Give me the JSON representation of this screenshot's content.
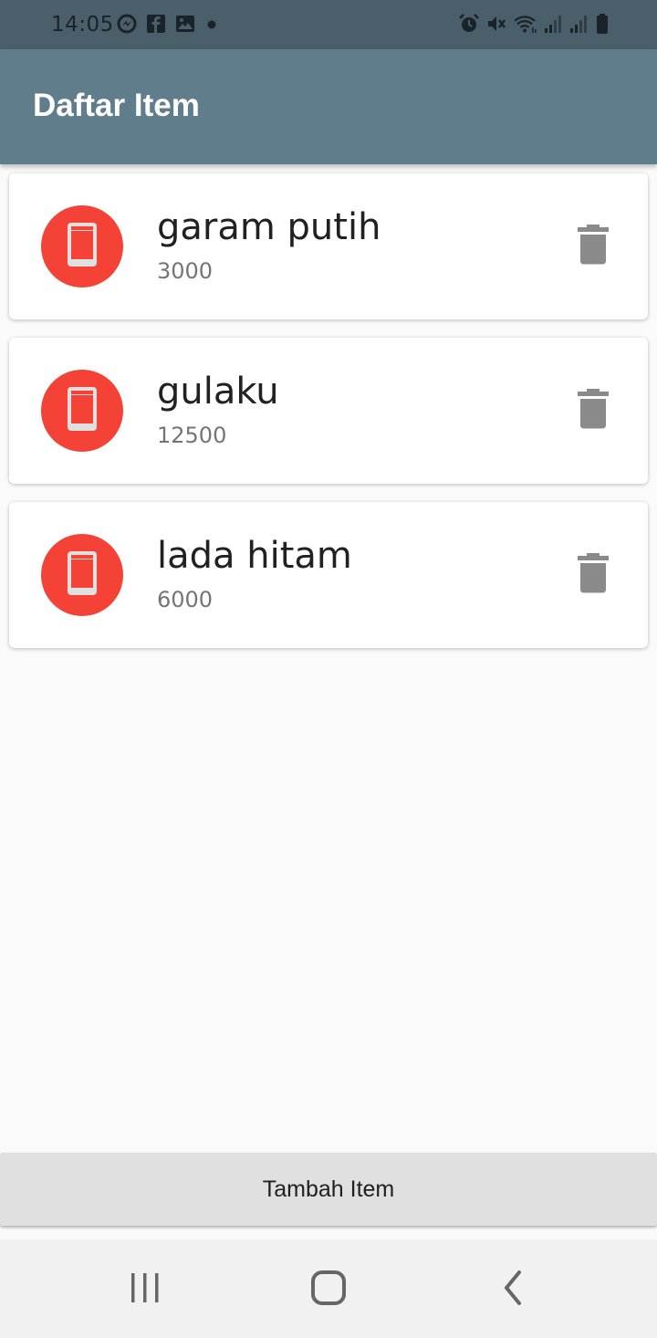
{
  "status_bar": {
    "time": "14:05",
    "left_icons": [
      "messenger-icon",
      "facebook-icon",
      "gallery-icon",
      "dot-icon"
    ],
    "right_icons": [
      "alarm-icon",
      "mute-icon",
      "wifi-icon",
      "signal-icon",
      "signal-icon",
      "battery-icon"
    ]
  },
  "app_bar": {
    "title": "Daftar Item",
    "color": "#607d8b"
  },
  "items": [
    {
      "name": "garam putih",
      "price": "3000",
      "icon": "phone-icon"
    },
    {
      "name": "gulaku",
      "price": "12500",
      "icon": "phone-icon"
    },
    {
      "name": "lada hitam",
      "price": "6000",
      "icon": "phone-icon"
    }
  ],
  "add_button": {
    "label": "Tambah Item"
  },
  "nav_bar": {
    "buttons": [
      "recent-apps-icon",
      "home-icon",
      "back-icon"
    ]
  },
  "colors": {
    "avatar": "#f44336",
    "delete_icon": "#8a8a8a",
    "background": "#fafafa"
  }
}
